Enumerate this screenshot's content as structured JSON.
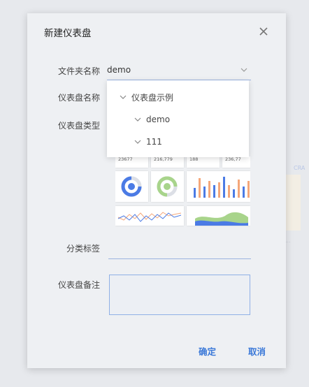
{
  "background": {
    "text_top": "CRA",
    "text_bottom": "..."
  },
  "dialog": {
    "title": "新建仪表盘",
    "labels": {
      "folder": "文件夹名称",
      "name": "仪表盘名称",
      "type": "仪表盘类型",
      "tags": "分类标签",
      "remark": "仪表盘备注"
    },
    "folder_value": "demo",
    "tags_value": "",
    "remark_value": "",
    "confirm": "确定",
    "cancel": "取消"
  },
  "dropdown": {
    "items": [
      {
        "label": "仪表盘示例",
        "level": 0
      },
      {
        "label": "demo",
        "level": 1
      },
      {
        "label": "111",
        "level": 1
      }
    ]
  },
  "thumbnails": {
    "numbers": [
      "23677",
      "216,779",
      "188",
      "236,77"
    ]
  },
  "colors": {
    "accent": "#3a78d8",
    "orange": "#f5a77a",
    "blue": "#4b7be5",
    "green": "#a8d48b"
  }
}
